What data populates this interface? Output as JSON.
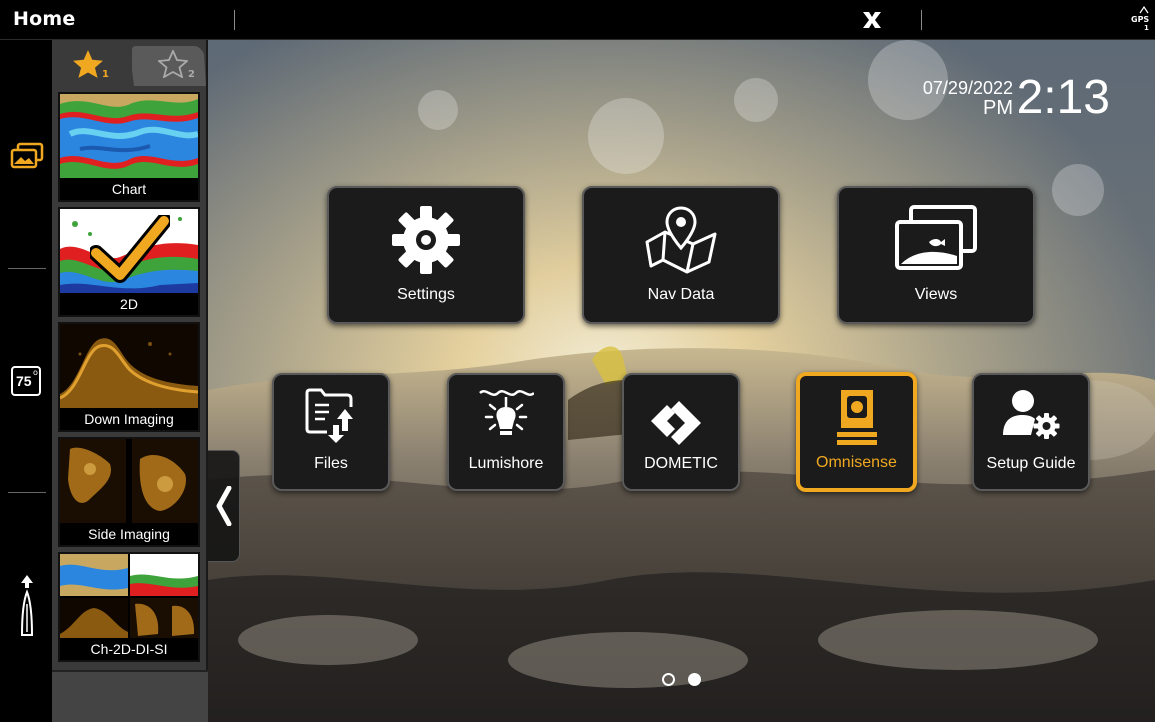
{
  "topbar": {
    "title": "Home",
    "close_icon": "x-close-icon",
    "gps_label": "GPS",
    "gps_sub": "1"
  },
  "rail": {
    "items": [
      {
        "icon": "views-icon"
      },
      {
        "icon": "temperature-icon",
        "value": "75"
      },
      {
        "icon": "boat-heading-icon"
      }
    ]
  },
  "favorites": {
    "tabs": [
      {
        "icon": "star-filled-icon",
        "index": "1",
        "selected": true
      },
      {
        "icon": "star-outline-icon",
        "index": "2",
        "selected": false
      }
    ],
    "tiles": [
      {
        "label": "Chart"
      },
      {
        "label": "2D",
        "checked": true
      },
      {
        "label": "Down Imaging"
      },
      {
        "label": "Side Imaging"
      },
      {
        "label": "Ch-2D-DI-SI"
      }
    ]
  },
  "datetime": {
    "date": "07/29/2022",
    "ampm": "PM",
    "time": "2:13"
  },
  "apps": {
    "row1": [
      {
        "label": "Settings",
        "icon": "gear-icon"
      },
      {
        "label": "Nav Data",
        "icon": "map-pin-icon"
      },
      {
        "label": "Views",
        "icon": "views-icon"
      }
    ],
    "row2": [
      {
        "label": "Files",
        "icon": "files-icon"
      },
      {
        "label": "Lumishore",
        "icon": "underwater-light-icon"
      },
      {
        "label": "DOMETIC",
        "icon": "dometic-logo-icon"
      },
      {
        "label": "Omnisense",
        "icon": "omnisense-camera-icon",
        "selected": true
      },
      {
        "label": "Setup Guide",
        "icon": "user-gear-icon"
      }
    ]
  },
  "pager": {
    "current_page": 2,
    "total_pages": 2
  },
  "colors": {
    "accent": "#f0a820",
    "button_bg": "#1b1b1b",
    "panel_bg": "#3a3a3a"
  }
}
